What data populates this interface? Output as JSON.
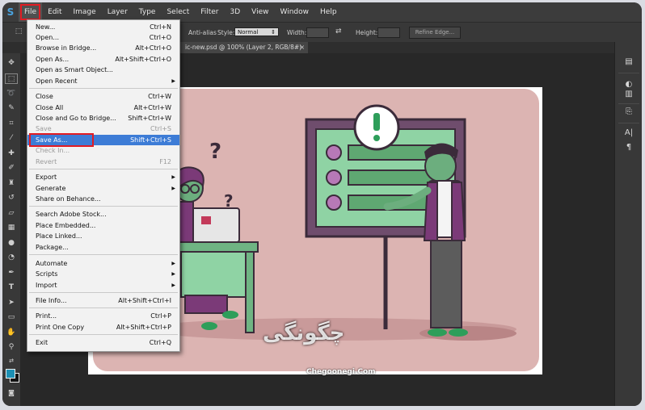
{
  "menubar": {
    "logo": "S",
    "items": [
      "File",
      "Edit",
      "Image",
      "Layer",
      "Type",
      "Select",
      "Filter",
      "3D",
      "View",
      "Window",
      "Help"
    ]
  },
  "options": {
    "anti_alias": "Anti-alias",
    "style_label": "Style:",
    "style_value": "Normal",
    "width_label": "Width:",
    "height_label": "Height:",
    "refine_edge": "Refine Edge..."
  },
  "document_tab": {
    "title": "ic-new.psd @ 100% (Layer 2, RGB/8#)",
    "close": "×"
  },
  "file_menu": {
    "items": [
      {
        "label": "New...",
        "shortcut": "Ctrl+N"
      },
      {
        "label": "Open...",
        "shortcut": "Ctrl+O"
      },
      {
        "label": "Browse in Bridge...",
        "shortcut": "Alt+Ctrl+O"
      },
      {
        "label": "Open As...",
        "shortcut": "Alt+Shift+Ctrl+O"
      },
      {
        "label": "Open as Smart Object...",
        "shortcut": ""
      },
      {
        "label": "Open Recent",
        "shortcut": "",
        "submenu": true
      },
      {
        "label": "Close",
        "shortcut": "Ctrl+W"
      },
      {
        "label": "Close All",
        "shortcut": "Alt+Ctrl+W"
      },
      {
        "label": "Close and Go to Bridge...",
        "shortcut": "Shift+Ctrl+W"
      },
      {
        "label": "Save",
        "shortcut": "Ctrl+S",
        "disabled": true
      },
      {
        "label": "Save As...",
        "shortcut": "Shift+Ctrl+S",
        "highlighted": true
      },
      {
        "label": "Check In...",
        "shortcut": "",
        "disabled": true
      },
      {
        "label": "Revert",
        "shortcut": "F12",
        "disabled": true
      },
      {
        "label": "Export",
        "shortcut": "",
        "submenu": true
      },
      {
        "label": "Generate",
        "shortcut": "",
        "submenu": true
      },
      {
        "label": "Share on Behance...",
        "shortcut": ""
      },
      {
        "label": "Search Adobe Stock...",
        "shortcut": ""
      },
      {
        "label": "Place Embedded...",
        "shortcut": ""
      },
      {
        "label": "Place Linked...",
        "shortcut": ""
      },
      {
        "label": "Package...",
        "shortcut": ""
      },
      {
        "label": "Automate",
        "shortcut": "",
        "submenu": true
      },
      {
        "label": "Scripts",
        "shortcut": "",
        "submenu": true
      },
      {
        "label": "Import",
        "shortcut": "",
        "submenu": true
      },
      {
        "label": "File Info...",
        "shortcut": "Alt+Shift+Ctrl+I"
      },
      {
        "label": "Print...",
        "shortcut": "Ctrl+P"
      },
      {
        "label": "Print One Copy",
        "shortcut": "Alt+Shift+Ctrl+P"
      },
      {
        "label": "Exit",
        "shortcut": "Ctrl+Q"
      }
    ]
  },
  "watermark": {
    "persian": "چگونگی",
    "url": "Chegoonegi.Com"
  },
  "colors": {
    "accent_highlight": "#3d7cd6",
    "annotation_red": "#e21b23",
    "foreground_color": "#1c8fb3",
    "illustration_bg": "#dcb4b2",
    "illustration_board": "#6f4d6d",
    "illustration_green": "#8fd3a4"
  },
  "tools": [
    "move-icon",
    "marquee-icon",
    "lasso-icon",
    "quick-select-icon",
    "crop-icon",
    "eyedropper-icon",
    "healing-icon",
    "brush-icon",
    "stamp-icon",
    "history-brush-icon",
    "eraser-icon",
    "gradient-icon",
    "blur-icon",
    "dodge-icon",
    "pen-icon",
    "type-icon",
    "path-select-icon",
    "shape-icon",
    "hand-icon",
    "zoom-icon"
  ],
  "right_panel_icons": [
    "layers-icon",
    "adjustments-icon",
    "properties-icon",
    "character-icon",
    "paragraph-icon"
  ]
}
